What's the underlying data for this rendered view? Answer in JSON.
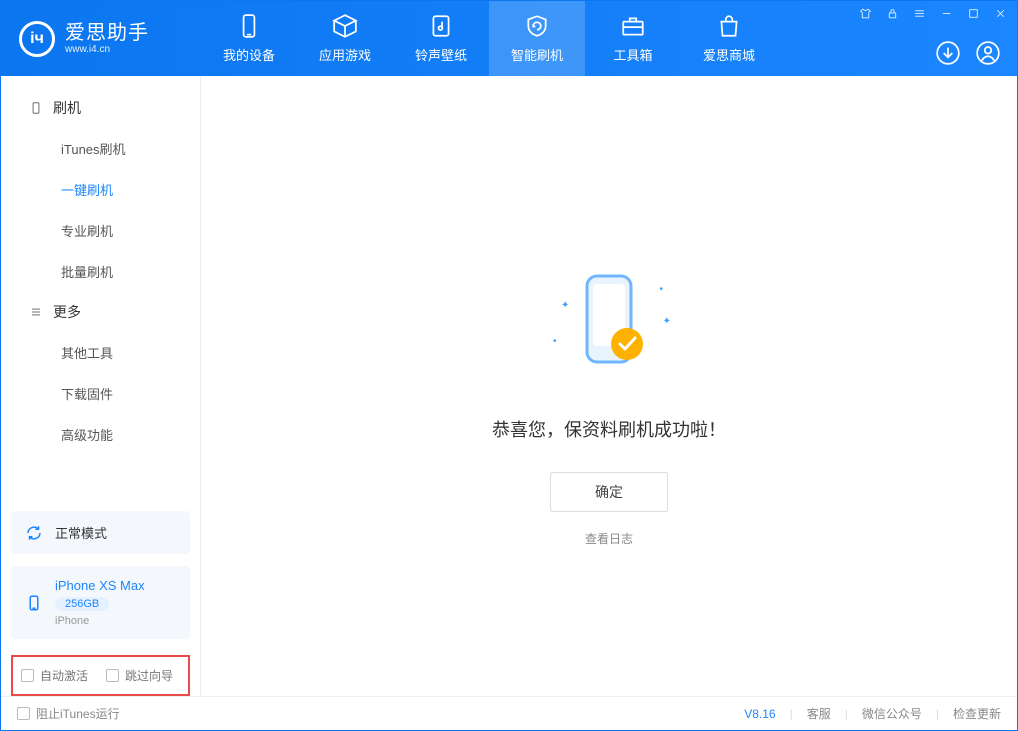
{
  "app": {
    "name_cn": "爱思助手",
    "name_en": "www.i4.cn"
  },
  "nav": {
    "my_device": "我的设备",
    "apps_games": "应用游戏",
    "ring_wall": "铃声壁纸",
    "smart_flash": "智能刷机",
    "toolbox": "工具箱",
    "store": "爱思商城"
  },
  "sidebar": {
    "group_flash": "刷机",
    "items_flash": {
      "itunes": "iTunes刷机",
      "onekey": "一键刷机",
      "pro": "专业刷机",
      "batch": "批量刷机"
    },
    "group_more": "更多",
    "items_more": {
      "other_tools": "其他工具",
      "download_fw": "下载固件",
      "advanced": "高级功能"
    }
  },
  "device": {
    "mode_label": "正常模式",
    "name": "iPhone XS Max",
    "capacity": "256GB",
    "type": "iPhone"
  },
  "options": {
    "auto_activate": "自动激活",
    "skip_guide": "跳过向导"
  },
  "main": {
    "success_msg": "恭喜您，保资料刷机成功啦！",
    "ok_btn": "确定",
    "view_log": "查看日志"
  },
  "footer": {
    "block_itunes": "阻止iTunes运行",
    "version": "V8.16",
    "support": "客服",
    "wechat": "微信公众号",
    "check_update": "检查更新"
  }
}
